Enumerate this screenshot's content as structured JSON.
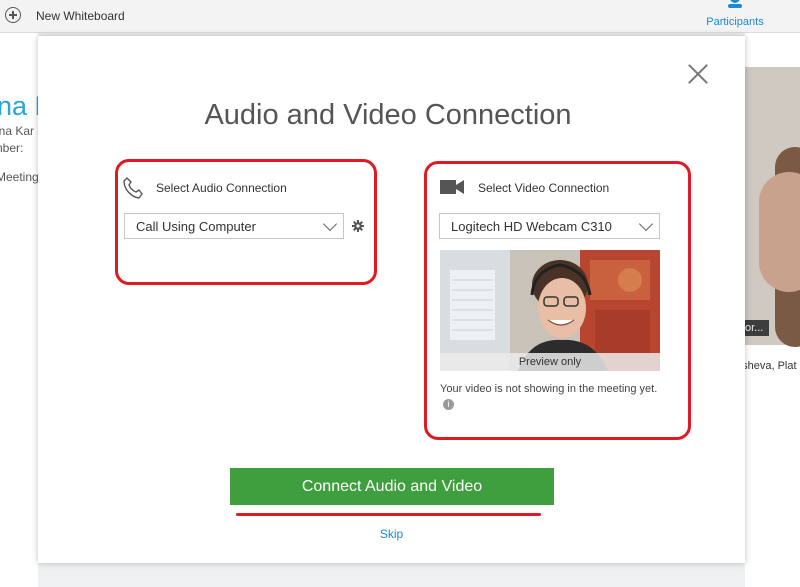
{
  "topbar": {
    "new_whiteboard": "New Whiteboard",
    "participants": "Participants"
  },
  "background": {
    "name_fragment": "na K",
    "lines": [
      "ina Kar",
      "nber:",
      "Meeting"
    ],
    "video_label": "or...",
    "right_text": "usheva, Plat"
  },
  "dialog": {
    "title": "Audio and Video Connection",
    "audio": {
      "label": "Select Audio Connection",
      "selected": "Call Using Computer",
      "icon": "phone-icon"
    },
    "video": {
      "label": "Select Video Connection",
      "selected": "Logitech HD Webcam C310",
      "preview_caption": "Preview only",
      "note": "Your video is not showing in the meeting yet.",
      "icon": "camera-icon"
    },
    "connect_button": "Connect Audio and Video",
    "skip": "Skip"
  },
  "colors": {
    "accent_blue": "#1a8ad4",
    "button_green": "#3f9e3e",
    "highlight_red": "#e01a22"
  }
}
